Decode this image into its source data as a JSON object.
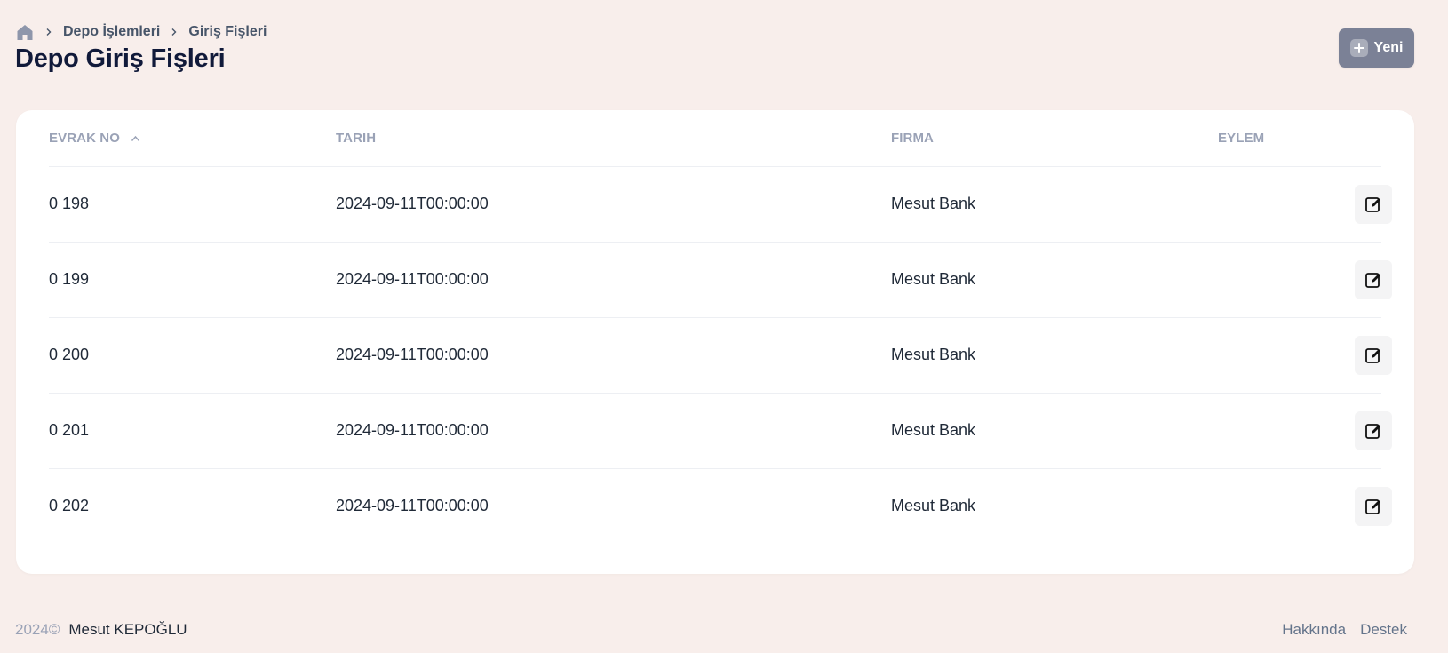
{
  "breadcrumb": {
    "home_icon": "home-icon",
    "items": [
      "Depo İşlemleri",
      "Giriş Fişleri"
    ]
  },
  "page_title": "Depo Giriş Fişleri",
  "new_button": {
    "label": "Yeni",
    "icon": "plus-icon"
  },
  "table": {
    "columns": [
      "EVRAK NO",
      "TARIH",
      "FIRMA",
      "EYLEM"
    ],
    "sort": {
      "column": "EVRAK NO",
      "direction": "ascending"
    },
    "rows": [
      {
        "evrak_no": "0 198",
        "tarih": "2024-09-11T00:00:00",
        "firma": "Mesut Bank"
      },
      {
        "evrak_no": "0 199",
        "tarih": "2024-09-11T00:00:00",
        "firma": "Mesut Bank"
      },
      {
        "evrak_no": "0 200",
        "tarih": "2024-09-11T00:00:00",
        "firma": "Mesut Bank"
      },
      {
        "evrak_no": "0 201",
        "tarih": "2024-09-11T00:00:00",
        "firma": "Mesut Bank"
      },
      {
        "evrak_no": "0 202",
        "tarih": "2024-09-11T00:00:00",
        "firma": "Mesut Bank"
      }
    ],
    "row_action_icon": "edit-icon"
  },
  "footer": {
    "year": "2024©",
    "author": "Mesut KEPOĞLU",
    "links": [
      "Hakkında",
      "Destek"
    ]
  },
  "colors": {
    "background": "#f8eeeb",
    "title": "#111a3a",
    "button": "#7b8196",
    "header_text": "#9aa2b6"
  }
}
